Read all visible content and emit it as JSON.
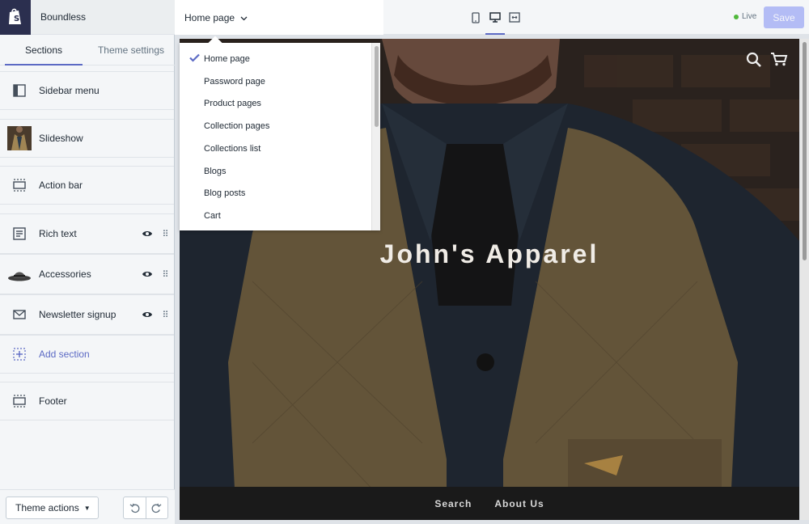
{
  "app": {
    "store_name": "Boundless"
  },
  "sidebar": {
    "tabs": [
      {
        "label": "Sections",
        "active": true
      },
      {
        "label": "Theme settings",
        "active": false
      }
    ],
    "sections": [
      {
        "label": "Sidebar menu",
        "icon": "sidebar-layout-icon"
      },
      {
        "label": "Slideshow",
        "icon": "slideshow-thumbnail"
      },
      {
        "label": "Action bar",
        "icon": "action-bar-icon"
      },
      {
        "label": "Rich text",
        "icon": "rich-text-icon",
        "visible": true
      },
      {
        "label": "Accessories",
        "icon": "hat-thumbnail",
        "visible": true
      },
      {
        "label": "Newsletter signup",
        "icon": "envelope-icon",
        "visible": true
      },
      {
        "label": "Add section",
        "icon": "add-section-icon"
      },
      {
        "label": "Footer",
        "icon": "footer-icon"
      }
    ],
    "theme_actions_label": "Theme actions"
  },
  "topbar": {
    "page_select_label": "Home page",
    "live_label": "Live",
    "save_label": "Save",
    "active_view": "desktop"
  },
  "dropdown": {
    "selected": "Home page",
    "items": [
      "Home page",
      "Password page",
      "Product pages",
      "Collection pages",
      "Collections list",
      "Blogs",
      "Blog posts",
      "Cart"
    ]
  },
  "preview": {
    "hero_title": "John's Apparel",
    "footer_links": [
      "Search",
      "About Us"
    ]
  },
  "colors": {
    "accent": "#5c6ac4",
    "live": "#50b83c",
    "save_disabled": "#b3bcf5",
    "logo_bg": "#2b2f4f"
  }
}
